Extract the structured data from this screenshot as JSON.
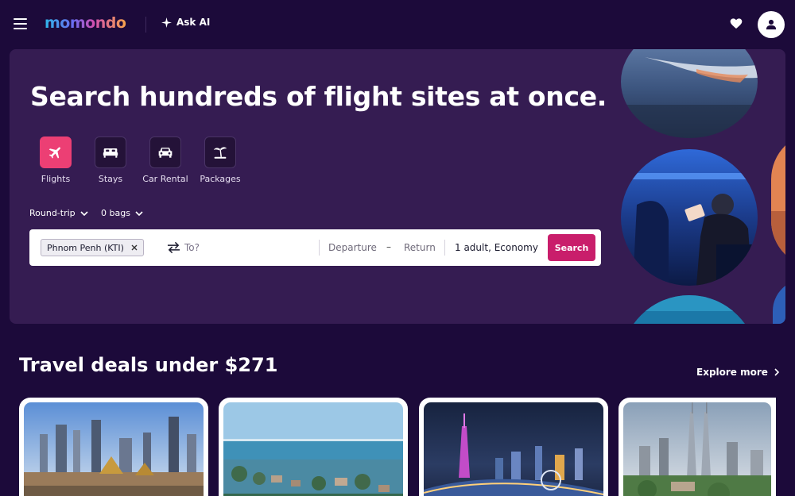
{
  "header": {
    "logo_text": "momondo",
    "ask_ai_label": "Ask AI"
  },
  "hero": {
    "title": "Search hundreds of flight sites at once.",
    "categories": [
      {
        "label": "Flights",
        "icon": "plane-icon",
        "active": true
      },
      {
        "label": "Stays",
        "icon": "bed-icon",
        "active": false
      },
      {
        "label": "Car Rental",
        "icon": "car-icon",
        "active": false
      },
      {
        "label": "Packages",
        "icon": "palm-tree-icon",
        "active": false
      }
    ],
    "trip_type": "Round-trip",
    "bags": "0 bags",
    "search": {
      "origin_chip": "Phnom Penh (KTI)",
      "destination_placeholder": "To?",
      "departure_label": "Departure",
      "date_separator": "–",
      "return_label": "Return",
      "travelers": "1 adult, Economy",
      "search_button": "Search"
    }
  },
  "deals": {
    "title": "Travel deals under $271",
    "explore_label": "Explore more",
    "cards": [
      {
        "image": "bangkok-skyline-photo"
      },
      {
        "image": "coastal-lagoon-photo"
      },
      {
        "image": "guangzhou-night-photo"
      },
      {
        "image": "kuala-lumpur-skyline-photo"
      }
    ]
  },
  "colors": {
    "page_bg": "#1c0a3a",
    "hero_bg": "#351c52",
    "accent_pink": "#ec3f74",
    "search_button": "#c91e6b"
  }
}
